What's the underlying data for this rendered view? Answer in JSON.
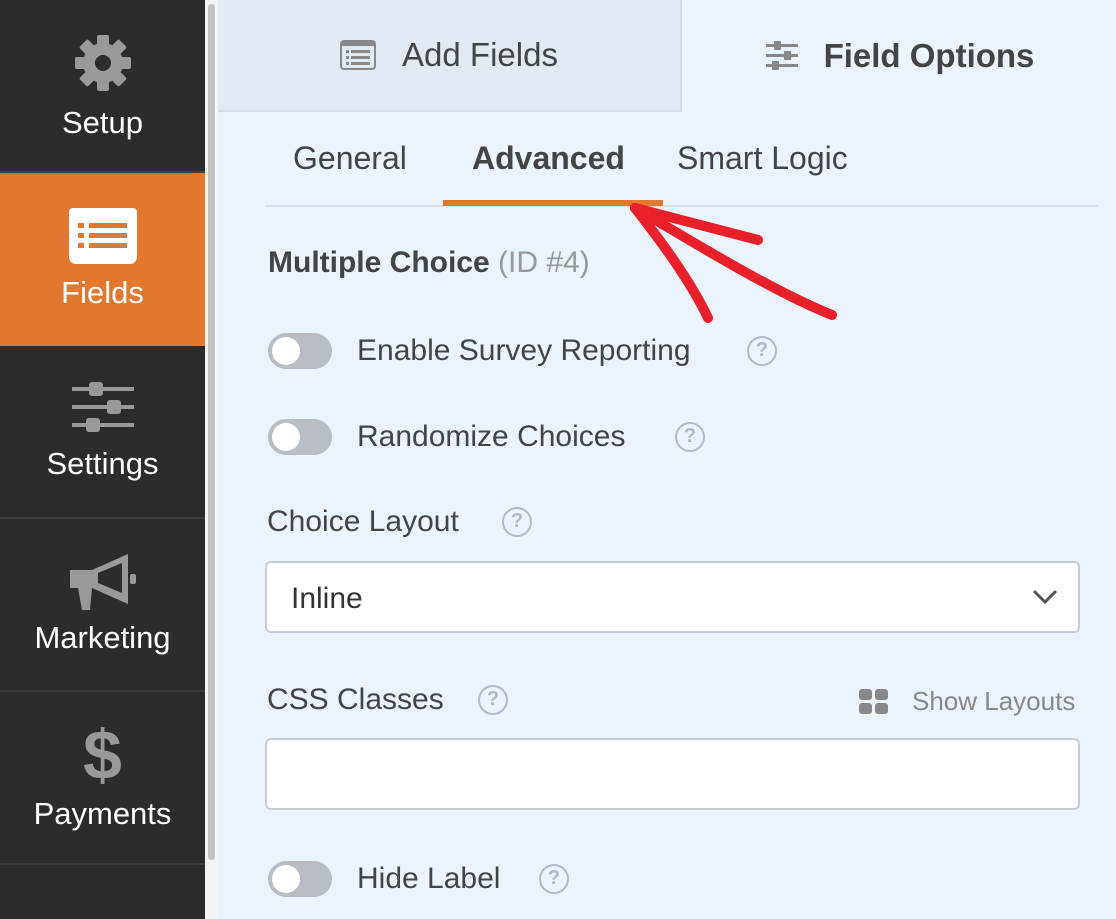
{
  "sidebar": {
    "items": [
      {
        "label": "Setup",
        "icon": "gear-icon",
        "active": false
      },
      {
        "label": "Fields",
        "icon": "list-icon",
        "active": true
      },
      {
        "label": "Settings",
        "icon": "sliders-icon",
        "active": false
      },
      {
        "label": "Marketing",
        "icon": "megaphone-icon",
        "active": false
      },
      {
        "label": "Payments",
        "icon": "dollar-icon",
        "active": false
      }
    ]
  },
  "top_tabs": [
    {
      "label": "Add Fields",
      "icon": "list-icon"
    },
    {
      "label": "Field Options",
      "icon": "sliders-icon",
      "active": true
    }
  ],
  "sub_tabs": [
    {
      "label": "General"
    },
    {
      "label": "Advanced",
      "active": true
    },
    {
      "label": "Smart Logic"
    }
  ],
  "field": {
    "title": "Multiple Choice",
    "id_label": "(ID #4)"
  },
  "options": {
    "survey_reporting": {
      "label": "Enable Survey Reporting",
      "on": false
    },
    "randomize": {
      "label": "Randomize Choices",
      "on": false
    },
    "choice_layout": {
      "label": "Choice Layout",
      "value": "Inline"
    },
    "css_classes": {
      "label": "CSS Classes",
      "value": "",
      "show_layouts": "Show Layouts"
    },
    "hide_label": {
      "label": "Hide Label",
      "on": false
    }
  },
  "help_glyph": "?",
  "colors": {
    "accent": "#e27730",
    "sidebar": "#2c2c2c",
    "annotation": "#e8202a"
  }
}
